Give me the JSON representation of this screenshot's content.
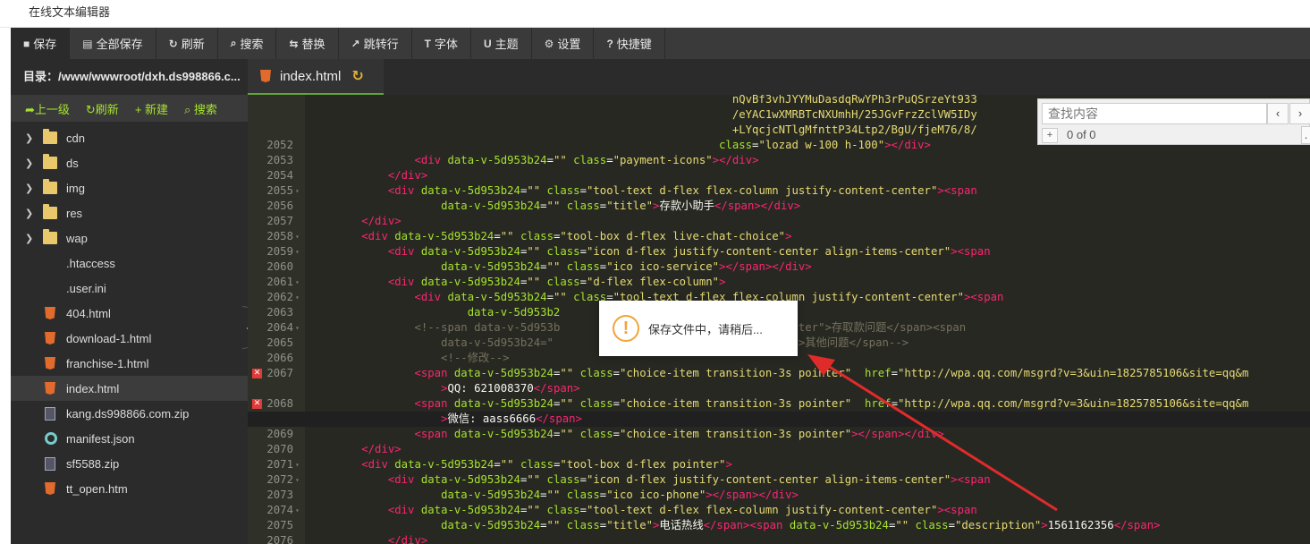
{
  "window": {
    "title": "在线文本编辑器"
  },
  "toolbar": {
    "items": [
      {
        "icon": "■",
        "label": "保存"
      },
      {
        "icon": "▤",
        "label": "全部保存"
      },
      {
        "icon": "↻",
        "label": "刷新"
      },
      {
        "icon": "⌕",
        "label": "搜索"
      },
      {
        "icon": "⇆",
        "label": "替换"
      },
      {
        "icon": "↗",
        "label": "跳转行"
      },
      {
        "icon": "T",
        "label": "字体"
      },
      {
        "icon": "U",
        "label": "主题"
      },
      {
        "icon": "⚙",
        "label": "设置"
      },
      {
        "icon": "?",
        "label": "快捷键"
      }
    ]
  },
  "sidebar": {
    "directory": "目录：/www/wwwroot/dxh.ds998866.c...",
    "actions": {
      "up": "➦上一级",
      "refresh": "↻刷新",
      "new": "+ 新建",
      "search": "⌕ 搜索"
    },
    "files": [
      {
        "name": "cdn",
        "type": "folder"
      },
      {
        "name": "ds",
        "type": "folder"
      },
      {
        "name": "img",
        "type": "folder"
      },
      {
        "name": "res",
        "type": "folder"
      },
      {
        "name": "wap",
        "type": "folder"
      },
      {
        "name": ".htaccess",
        "type": "plain"
      },
      {
        "name": ".user.ini",
        "type": "plain"
      },
      {
        "name": "404.html",
        "type": "html"
      },
      {
        "name": "download-1.html",
        "type": "html"
      },
      {
        "name": "franchise-1.html",
        "type": "html"
      },
      {
        "name": "index.html",
        "type": "html",
        "active": true
      },
      {
        "name": "kang.ds998866.com.zip",
        "type": "zip"
      },
      {
        "name": "manifest.json",
        "type": "json"
      },
      {
        "name": "sf5588.zip",
        "type": "zip"
      },
      {
        "name": "tt_open.htm",
        "type": "html"
      }
    ]
  },
  "tab": {
    "name": "index.html",
    "reload_icon": "↻"
  },
  "find": {
    "placeholder": "查找内容",
    "prev": "‹",
    "next": "›",
    "plus": "+",
    "count": "0 of 0",
    "dot": "."
  },
  "toast": {
    "icon": "!",
    "message": "保存文件中，请稍后..."
  },
  "editor": {
    "lines": [
      {
        "num": "",
        "indent": 0,
        "tokens": [
          [
            "s",
            "                                                                nQvBf3vhJYYMuDasdqRwYPh3rPuQSrzeYt933"
          ]
        ]
      },
      {
        "num": "",
        "indent": 0,
        "tokens": [
          [
            "s",
            "                                                                /eYAC1wXMRBTcNXUmhH/25JGvFrzZclVW5IDy"
          ]
        ]
      },
      {
        "num": "",
        "indent": 0,
        "tokens": [
          [
            "s",
            "                                                                +LYqcjcNTlgMfnttP34Ltp2/BgU/fjeM76/8/"
          ]
        ]
      },
      {
        "num": "2052",
        "fold": false,
        "tokens": [
          [
            "w",
            "                                                              "
          ],
          [
            "a",
            "class"
          ],
          [
            "w",
            "="
          ],
          [
            "s",
            "\"lozad w-100 h-100\""
          ],
          [
            "t",
            "></div>"
          ]
        ]
      },
      {
        "num": "2053",
        "fold": false,
        "tokens": [
          [
            "w",
            "                "
          ],
          [
            "t",
            "<div "
          ],
          [
            "a",
            "data-v-5d953b24"
          ],
          [
            "w",
            "="
          ],
          [
            "s",
            "\"\""
          ],
          [
            "a",
            " class"
          ],
          [
            "w",
            "="
          ],
          [
            "s",
            "\"payment-icons\""
          ],
          [
            "t",
            "></div>"
          ]
        ]
      },
      {
        "num": "2054",
        "fold": false,
        "tokens": [
          [
            "w",
            "            "
          ],
          [
            "t",
            "</div>"
          ]
        ]
      },
      {
        "num": "2055",
        "fold": true,
        "tokens": [
          [
            "w",
            "            "
          ],
          [
            "t",
            "<div "
          ],
          [
            "a",
            "data-v-5d953b24"
          ],
          [
            "w",
            "="
          ],
          [
            "s",
            "\"\""
          ],
          [
            "a",
            " class"
          ],
          [
            "w",
            "="
          ],
          [
            "s",
            "\"tool-text d-flex flex-column justify-content-center\""
          ],
          [
            "t",
            "><span"
          ]
        ]
      },
      {
        "num": "2056",
        "fold": false,
        "tokens": [
          [
            "w",
            "                    "
          ],
          [
            "a",
            "data-v-5d953b24"
          ],
          [
            "w",
            "="
          ],
          [
            "s",
            "\"\""
          ],
          [
            "a",
            " class"
          ],
          [
            "w",
            "="
          ],
          [
            "s",
            "\"title\""
          ],
          [
            "t",
            ">"
          ],
          [
            "w",
            "存款小助手"
          ],
          [
            "t",
            "</span></div>"
          ]
        ]
      },
      {
        "num": "2057",
        "fold": false,
        "tokens": [
          [
            "w",
            "        "
          ],
          [
            "t",
            "</div>"
          ]
        ]
      },
      {
        "num": "2058",
        "fold": true,
        "tokens": [
          [
            "w",
            "        "
          ],
          [
            "t",
            "<div "
          ],
          [
            "a",
            "data-v-5d953b24"
          ],
          [
            "w",
            "="
          ],
          [
            "s",
            "\"\""
          ],
          [
            "a",
            " class"
          ],
          [
            "w",
            "="
          ],
          [
            "s",
            "\"tool-box d-flex live-chat-choice\""
          ],
          [
            "t",
            ">"
          ]
        ]
      },
      {
        "num": "2059",
        "fold": true,
        "tokens": [
          [
            "w",
            "            "
          ],
          [
            "t",
            "<div "
          ],
          [
            "a",
            "data-v-5d953b24"
          ],
          [
            "w",
            "="
          ],
          [
            "s",
            "\"\""
          ],
          [
            "a",
            " class"
          ],
          [
            "w",
            "="
          ],
          [
            "s",
            "\"icon d-flex justify-content-center align-items-center\""
          ],
          [
            "t",
            "><span"
          ]
        ]
      },
      {
        "num": "2060",
        "fold": false,
        "tokens": [
          [
            "w",
            "                    "
          ],
          [
            "a",
            "data-v-5d953b24"
          ],
          [
            "w",
            "="
          ],
          [
            "s",
            "\"\""
          ],
          [
            "a",
            " class"
          ],
          [
            "w",
            "="
          ],
          [
            "s",
            "\"ico ico-service\""
          ],
          [
            "t",
            "></span></div>"
          ]
        ]
      },
      {
        "num": "2061",
        "fold": true,
        "tokens": [
          [
            "w",
            "            "
          ],
          [
            "t",
            "<div "
          ],
          [
            "a",
            "data-v-5d953b24"
          ],
          [
            "w",
            "="
          ],
          [
            "s",
            "\"\""
          ],
          [
            "a",
            " class"
          ],
          [
            "w",
            "="
          ],
          [
            "s",
            "\"d-flex flex-column\""
          ],
          [
            "t",
            ">"
          ]
        ]
      },
      {
        "num": "2062",
        "fold": true,
        "tokens": [
          [
            "w",
            "                "
          ],
          [
            "t",
            "<div "
          ],
          [
            "a",
            "data-v-5d953b24"
          ],
          [
            "w",
            "="
          ],
          [
            "s",
            "\"\""
          ],
          [
            "a",
            " class"
          ],
          [
            "w",
            "="
          ],
          [
            "s",
            "\"tool-text d-flex flex-column justify-content-center\""
          ],
          [
            "t",
            "><span"
          ]
        ]
      },
      {
        "num": "2063",
        "fold": false,
        "tokens": [
          [
            "w",
            "                        "
          ],
          [
            "a",
            "data-v-5d953b2"
          ],
          [
            "w",
            "                      "
          ],
          [
            "t",
            "span></div>"
          ]
        ]
      },
      {
        "num": "2064",
        "fold": true,
        "tokens": [
          [
            "w",
            "                "
          ],
          [
            "c",
            "<!--span data-v-5d953b"
          ],
          [
            "w",
            "                      "
          ],
          [
            "c",
            "sition-3s pointer\">存取款问题</span><span"
          ]
        ]
      },
      {
        "num": "2065",
        "fold": false,
        "tokens": [
          [
            "w",
            "                    "
          ],
          [
            "c",
            "data-v-5d953b24=\""
          ],
          [
            "w",
            "                        "
          ],
          [
            "c",
            "n-3s pointer\">其他问题</span-->"
          ]
        ]
      },
      {
        "num": "2066",
        "fold": false,
        "tokens": [
          [
            "w",
            "                    "
          ],
          [
            "c",
            "<!--修改-->"
          ]
        ]
      },
      {
        "num": "2067",
        "fold": false,
        "err": true,
        "tokens": [
          [
            "w",
            "                "
          ],
          [
            "t",
            "<span "
          ],
          [
            "a",
            "data-v-5d953b24"
          ],
          [
            "w",
            "="
          ],
          [
            "s",
            "\"\""
          ],
          [
            "a",
            " class"
          ],
          [
            "w",
            "="
          ],
          [
            "s",
            "\"choice-item transition-3s pointer\""
          ],
          [
            "w",
            "  "
          ],
          [
            "a",
            "href"
          ],
          [
            "w",
            "="
          ],
          [
            "s",
            "\"http://wpa.qq.com/msgrd?v=3&uin=1825785106&site=qq&m"
          ]
        ]
      },
      {
        "num": "",
        "tokens": [
          [
            "w",
            "                    "
          ],
          [
            "t",
            ">"
          ],
          [
            "w",
            "QQ: 621008370"
          ],
          [
            "t",
            "</span>"
          ]
        ]
      },
      {
        "num": "2068",
        "fold": false,
        "err": true,
        "tokens": [
          [
            "w",
            "                "
          ],
          [
            "t",
            "<span "
          ],
          [
            "a",
            "data-v-5d953b24"
          ],
          [
            "w",
            "="
          ],
          [
            "s",
            "\"\""
          ],
          [
            "a",
            " class"
          ],
          [
            "w",
            "="
          ],
          [
            "s",
            "\"choice-item transition-3s pointer\""
          ],
          [
            "w",
            "  "
          ],
          [
            "a",
            "href"
          ],
          [
            "w",
            "="
          ],
          [
            "s",
            "\"http://wpa.qq.com/msgrd?v=3&uin=1825785106&site=qq&m"
          ]
        ]
      },
      {
        "num": "",
        "hl": true,
        "tokens": [
          [
            "w",
            "                    "
          ],
          [
            "t",
            ">"
          ],
          [
            "w",
            "微信: aass6666"
          ],
          [
            "t",
            "</span>"
          ]
        ]
      },
      {
        "num": "2069",
        "fold": false,
        "tokens": [
          [
            "w",
            "                "
          ],
          [
            "t",
            "<span "
          ],
          [
            "a",
            "data-v-5d953b24"
          ],
          [
            "w",
            "="
          ],
          [
            "s",
            "\"\""
          ],
          [
            "a",
            " class"
          ],
          [
            "w",
            "="
          ],
          [
            "s",
            "\"choice-item transition-3s pointer\""
          ],
          [
            "t",
            "></span></div>"
          ]
        ]
      },
      {
        "num": "2070",
        "fold": false,
        "tokens": [
          [
            "w",
            "        "
          ],
          [
            "t",
            "</div>"
          ]
        ]
      },
      {
        "num": "2071",
        "fold": true,
        "tokens": [
          [
            "w",
            "        "
          ],
          [
            "t",
            "<div "
          ],
          [
            "a",
            "data-v-5d953b24"
          ],
          [
            "w",
            "="
          ],
          [
            "s",
            "\"\""
          ],
          [
            "a",
            " class"
          ],
          [
            "w",
            "="
          ],
          [
            "s",
            "\"tool-box d-flex pointer\""
          ],
          [
            "t",
            ">"
          ]
        ]
      },
      {
        "num": "2072",
        "fold": true,
        "tokens": [
          [
            "w",
            "            "
          ],
          [
            "t",
            "<div "
          ],
          [
            "a",
            "data-v-5d953b24"
          ],
          [
            "w",
            "="
          ],
          [
            "s",
            "\"\""
          ],
          [
            "a",
            " class"
          ],
          [
            "w",
            "="
          ],
          [
            "s",
            "\"icon d-flex justify-content-center align-items-center\""
          ],
          [
            "t",
            "><span"
          ]
        ]
      },
      {
        "num": "2073",
        "fold": false,
        "tokens": [
          [
            "w",
            "                    "
          ],
          [
            "a",
            "data-v-5d953b24"
          ],
          [
            "w",
            "="
          ],
          [
            "s",
            "\"\""
          ],
          [
            "a",
            " class"
          ],
          [
            "w",
            "="
          ],
          [
            "s",
            "\"ico ico-phone\""
          ],
          [
            "t",
            "></span></div>"
          ]
        ]
      },
      {
        "num": "2074",
        "fold": true,
        "tokens": [
          [
            "w",
            "            "
          ],
          [
            "t",
            "<div "
          ],
          [
            "a",
            "data-v-5d953b24"
          ],
          [
            "w",
            "="
          ],
          [
            "s",
            "\"\""
          ],
          [
            "a",
            " class"
          ],
          [
            "w",
            "="
          ],
          [
            "s",
            "\"tool-text d-flex flex-column justify-content-center\""
          ],
          [
            "t",
            "><span"
          ]
        ]
      },
      {
        "num": "2075",
        "fold": false,
        "tokens": [
          [
            "w",
            "                    "
          ],
          [
            "a",
            "data-v-5d953b24"
          ],
          [
            "w",
            "="
          ],
          [
            "s",
            "\"\""
          ],
          [
            "a",
            " class"
          ],
          [
            "w",
            "="
          ],
          [
            "s",
            "\"title\""
          ],
          [
            "t",
            ">"
          ],
          [
            "w",
            "电话热线"
          ],
          [
            "t",
            "</span><span "
          ],
          [
            "a",
            "data-v-5d953b24"
          ],
          [
            "w",
            "="
          ],
          [
            "s",
            "\"\""
          ],
          [
            "a",
            " class"
          ],
          [
            "w",
            "="
          ],
          [
            "s",
            "\"description\""
          ],
          [
            "t",
            ">"
          ],
          [
            "w",
            "1561162356"
          ],
          [
            "t",
            "</span>"
          ]
        ]
      },
      {
        "num": "2076",
        "fold": false,
        "tokens": [
          [
            "w",
            "            "
          ],
          [
            "t",
            "</div>"
          ]
        ]
      }
    ]
  },
  "colors": {
    "toolbar_bg": "#3a3a3a",
    "sidebar_bg": "#2b2b2b",
    "editor_bg": "#272822",
    "accent_green": "#5fa33a",
    "arrow_red": "#e02b2b",
    "warn_orange": "#f2a33a"
  }
}
